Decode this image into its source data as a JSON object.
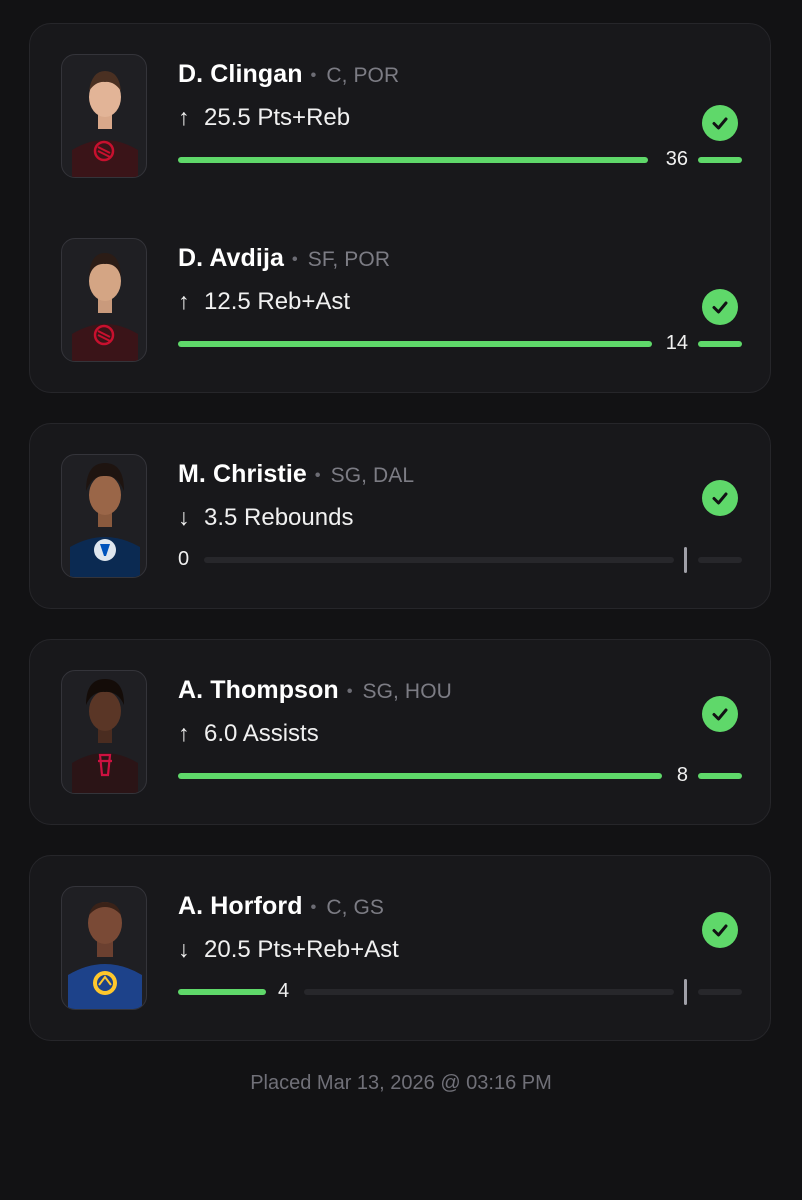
{
  "colors": {
    "background": "#121214",
    "card": "#18181b",
    "accent_green": "#5fd86a",
    "muted": "#7c7c84"
  },
  "legs": [
    {
      "name": "D. Clingan",
      "position": "C, POR",
      "arrow": "↑",
      "line": "25.5 Pts+Reb",
      "actual": "36",
      "status_icon": "check-circle-icon",
      "team_icon": "trail-blazers-logo-icon"
    },
    {
      "name": "D. Avdija",
      "position": "SF, POR",
      "arrow": "↑",
      "line": "12.5 Reb+Ast",
      "actual": "14",
      "status_icon": "check-circle-icon",
      "team_icon": "trail-blazers-logo-icon"
    },
    {
      "name": "M. Christie",
      "position": "SG, DAL",
      "arrow": "↓",
      "line": "3.5 Rebounds",
      "actual": "0",
      "status_icon": "check-circle-icon",
      "team_icon": "mavericks-logo-icon"
    },
    {
      "name": "A. Thompson",
      "position": "SG, HOU",
      "arrow": "↑",
      "line": "6.0 Assists",
      "actual": "8",
      "status_icon": "check-circle-icon",
      "team_icon": "rockets-logo-icon"
    },
    {
      "name": "A. Horford",
      "position": "C, GS",
      "arrow": "↓",
      "line": "20.5 Pts+Reb+Ast",
      "actual": "4",
      "status_icon": "check-circle-icon",
      "team_icon": "warriors-logo-icon"
    }
  ],
  "footer": {
    "placed": "Placed Mar 13, 2026 @ 03:16 PM"
  }
}
